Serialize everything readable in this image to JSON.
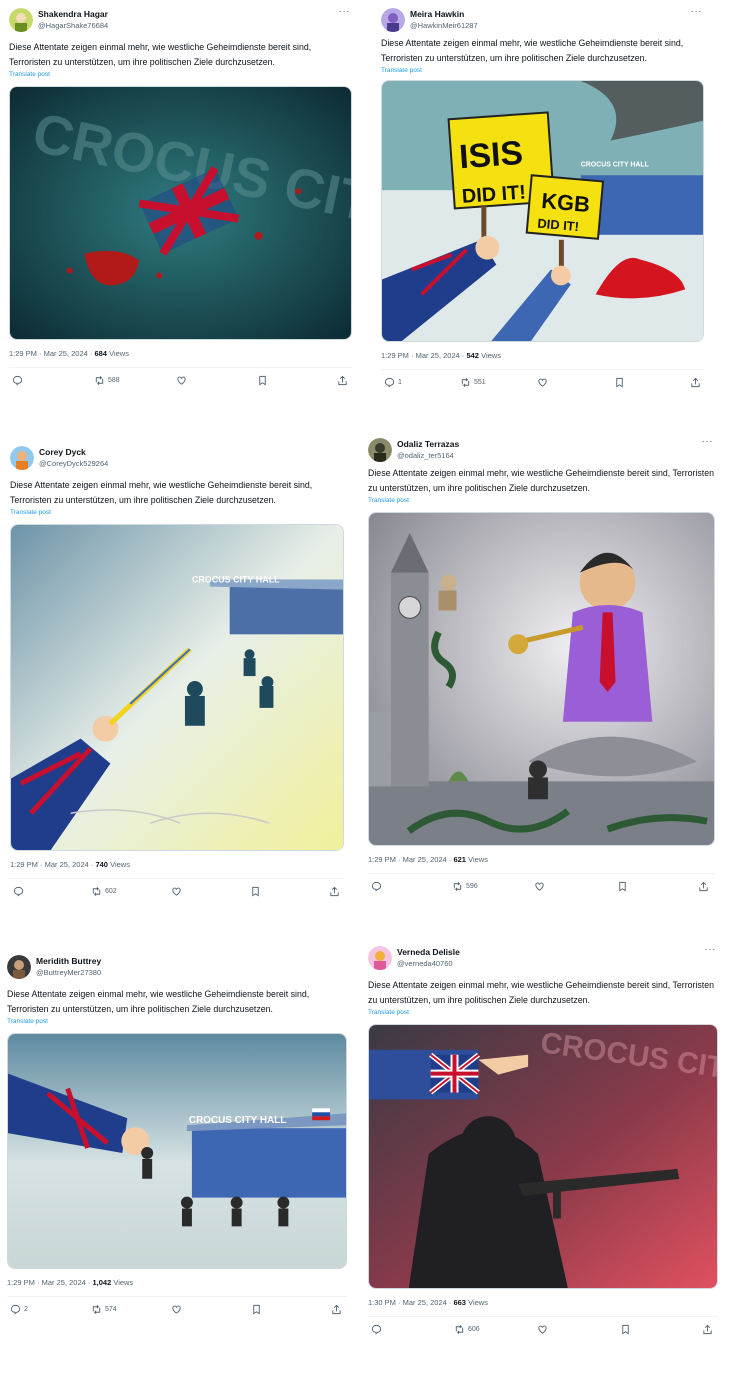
{
  "common": {
    "text": "Diese Attentate zeigen einmal mehr, wie westliche Geheimdienste bereit sind, Terroristen zu unterstützen, um ihre politischen Ziele durchzusetzen.",
    "translate": "Translate post",
    "more": "···",
    "views_label": "Views"
  },
  "tweets": [
    {
      "name": "Shakendra Hagar",
      "handle": "@HagarShake76684",
      "time": "1:29 PM · Mar 25, 2024 · ",
      "views": "684",
      "replies": "",
      "reposts": "588",
      "likes": "",
      "image": "Crocus City illustration with flag in red splatter",
      "image_text": "CROCUS CITY"
    },
    {
      "name": "Meira Hawkin",
      "handle": "@HawkinMeir61287",
      "time": "1:29 PM · Mar 25, 2024 · ",
      "views": "542",
      "replies": "1",
      "reposts": "551",
      "likes": "",
      "image": "Signs ISIS did it / KGB did it",
      "sign1a": "ISIS",
      "sign1b": "DID IT!",
      "sign2a": "KGB",
      "sign2b": "DID IT!",
      "image_text": "CROCUS CITY HALL"
    },
    {
      "name": "Corey Dyck",
      "handle": "@CoreyDyck529264",
      "time": "1:29 PM · Mar 25, 2024 · ",
      "views": "740",
      "replies": "",
      "reposts": "602",
      "likes": "",
      "image": "Soldiers running toward Crocus City Hall",
      "image_text": "CROCUS CITY HALL"
    },
    {
      "name": "Odaliz Terrazas",
      "handle": "@odaliz_ter5164",
      "time": "1:29 PM · Mar 25, 2024 · ",
      "views": "621",
      "replies": "",
      "reposts": "596",
      "likes": "",
      "image": "Snake charmer with Big Ben"
    },
    {
      "name": "Meridith Buttrey",
      "handle": "@ButtreyMer27380",
      "time": "1:29 PM · Mar 25, 2024 · ",
      "views": "1,042",
      "replies": "2",
      "reposts": "574",
      "likes": "",
      "image": "Chess pawns at Crocus City Hall",
      "image_text": "CROCUS CITY HALL"
    },
    {
      "name": "Verneda Delisle",
      "handle": "@verneda40760",
      "time": "1:30 PM · Mar 25, 2024 · ",
      "views": "663",
      "replies": "",
      "reposts": "606",
      "likes": "",
      "image": "Gunman with pointing hand",
      "image_text": "CROCUS CITY HALL"
    }
  ],
  "colors": {
    "accent": "#1d9bf0",
    "muted": "#536471",
    "flag_blue": "#1f3d8a",
    "flag_red": "#c8102e"
  }
}
